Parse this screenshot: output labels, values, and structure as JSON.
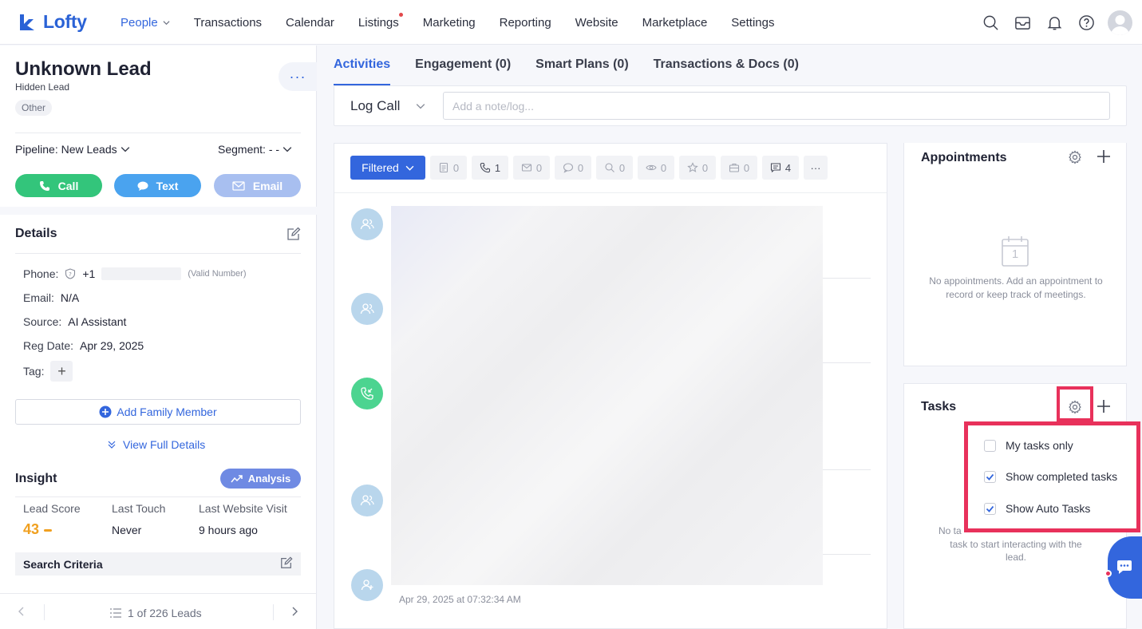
{
  "app": {
    "logo_text": "Lofty",
    "brand_color": "#2a62d6"
  },
  "nav": {
    "items": [
      {
        "label": "People",
        "active": true,
        "dropdown": true
      },
      {
        "label": "Transactions"
      },
      {
        "label": "Calendar"
      },
      {
        "label": "Listings",
        "badge_dot": true
      },
      {
        "label": "Marketing"
      },
      {
        "label": "Reporting"
      },
      {
        "label": "Website"
      },
      {
        "label": "Marketplace"
      },
      {
        "label": "Settings"
      }
    ],
    "icons": [
      "search-icon",
      "inbox-icon",
      "bell-icon",
      "help-icon",
      "user-avatar"
    ]
  },
  "lead": {
    "name": "Unknown Lead",
    "subtitle": "Hidden Lead",
    "tag": "Other",
    "more_label": "···",
    "pipeline_label": "Pipeline: New Leads",
    "segment_label": "Segment: - -",
    "actions": {
      "call": "Call",
      "text": "Text",
      "email": "Email"
    },
    "colors": {
      "call": "#33c57b",
      "text": "#4aa3ef",
      "email": "#a8bff0"
    }
  },
  "details": {
    "title": "Details",
    "phone_label": "Phone:",
    "phone_prefix": "+1",
    "phone_note": "(Valid Number)",
    "email_label": "Email:",
    "email_value": "N/A",
    "source_label": "Source:",
    "source_value": "AI Assistant",
    "reg_label": "Reg Date:",
    "reg_value": "Apr 29, 2025",
    "tag_label": "Tag:",
    "add_family": "Add Family Member",
    "view_full": "View Full Details"
  },
  "insight": {
    "title": "Insight",
    "analysis_label": "Analysis",
    "lead_score_label": "Lead Score",
    "lead_score_value": "43",
    "last_touch_label": "Last Touch",
    "last_touch_value": "Never",
    "last_visit_label": "Last Website Visit",
    "last_visit_value": "9 hours ago",
    "search_criteria": "Search Criteria"
  },
  "pager": {
    "text": "1 of 226 Leads"
  },
  "tabs": [
    {
      "label": "Activities",
      "active": true
    },
    {
      "label": "Engagement (0)"
    },
    {
      "label": "Smart Plans (0)"
    },
    {
      "label": "Transactions & Docs (0)"
    }
  ],
  "log": {
    "type_label": "Log Call",
    "placeholder": "Add a note/log..."
  },
  "filters": {
    "filtered_label": "Filtered",
    "chips": [
      {
        "icon": "note-icon",
        "count": "0"
      },
      {
        "icon": "phone-icon",
        "count": "1"
      },
      {
        "icon": "mail-icon",
        "count": "0"
      },
      {
        "icon": "chat-icon",
        "count": "0"
      },
      {
        "icon": "search-icon",
        "count": "0"
      },
      {
        "icon": "eye-icon",
        "count": "0"
      },
      {
        "icon": "star-icon",
        "count": "0"
      },
      {
        "icon": "briefcase-icon",
        "count": "0"
      },
      {
        "icon": "message-icon",
        "count": "4"
      }
    ],
    "more_label": "···"
  },
  "activity": {
    "timestamp": "Apr 29, 2025 at 07:32:34 AM"
  },
  "appointments": {
    "title": "Appointments",
    "calendar_day": "1",
    "empty_text": "No appointments. Add an appointment to record or keep track of meetings."
  },
  "tasks": {
    "title": "Tasks",
    "empty_text_partial_1": "No ta",
    "empty_text_partial_2": "task to start interacting with the",
    "empty_text_partial_3": "lead.",
    "settings_menu": [
      {
        "label": "My tasks only",
        "checked": false
      },
      {
        "label": "Show completed tasks",
        "checked": true
      },
      {
        "label": "Show Auto Tasks",
        "checked": true
      }
    ]
  },
  "highlight_color": "#e8315b"
}
